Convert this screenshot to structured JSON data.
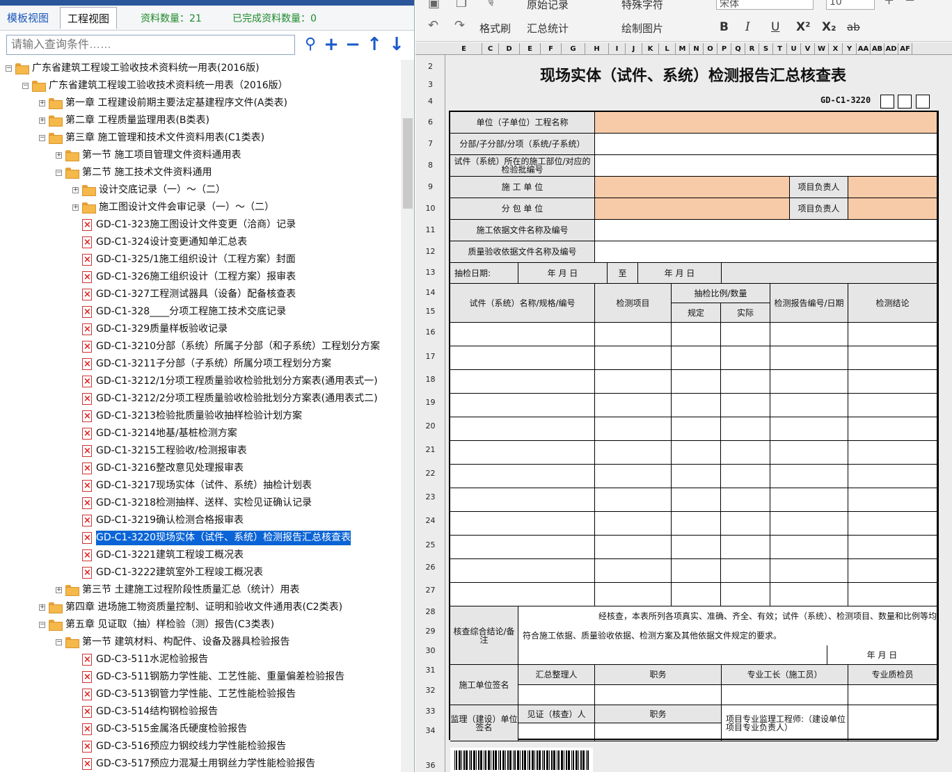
{
  "left_tabs": [
    "模板视图",
    "工程视图"
  ],
  "stats": {
    "count_label": "资料数量：21",
    "done_label": "已完成资料数量：0"
  },
  "search": {
    "placeholder": "请输入查询条件……"
  },
  "tools": [
    "⚲",
    "+",
    "−",
    "↑",
    "↓"
  ],
  "tree": [
    {
      "d": 0,
      "t": "广东省建筑工程竣工验收技术资料统一用表(2016版)",
      "k": "f",
      "e": "-"
    },
    {
      "d": 1,
      "t": "广东省建筑工程竣工验收技术资料统一用表（2016版）",
      "k": "f",
      "e": "-"
    },
    {
      "d": 2,
      "t": "第一章 工程建设前期主要法定基建程序文件(A类表)",
      "k": "f",
      "e": "+"
    },
    {
      "d": 2,
      "t": "第二章 工程质量监理用表(B类表)",
      "k": "f",
      "e": "+"
    },
    {
      "d": 2,
      "t": "第三章 施工管理和技术文件资料用表(C1类表)",
      "k": "f",
      "e": "-"
    },
    {
      "d": 3,
      "t": "第一节 施工项目管理文件资料通用表",
      "k": "f",
      "e": "+"
    },
    {
      "d": 3,
      "t": "第二节 施工技术文件资料通用",
      "k": "f",
      "e": "-"
    },
    {
      "d": 4,
      "t": "设计交底记录（一）～（二）",
      "k": "f",
      "e": "+"
    },
    {
      "d": 4,
      "t": "施工图设计文件会审记录（一）～（二）",
      "k": "f",
      "e": "+"
    },
    {
      "d": 4,
      "t": "GD-C1-323施工图设计文件变更（洽商）记录",
      "k": "d"
    },
    {
      "d": 4,
      "t": "GD-C1-324设计变更通知单汇总表",
      "k": "d"
    },
    {
      "d": 4,
      "t": "GD-C1-325/1施工组织设计（工程方案）封面",
      "k": "d"
    },
    {
      "d": 4,
      "t": "GD-C1-326施工组织设计（工程方案）报审表",
      "k": "d"
    },
    {
      "d": 4,
      "t": "GD-C1-327工程测试器具（设备）配备核查表",
      "k": "d"
    },
    {
      "d": 4,
      "t": "GD-C1-328____分项工程施工技术交底记录",
      "k": "d"
    },
    {
      "d": 4,
      "t": "GD-C1-329质量样板验收记录",
      "k": "d"
    },
    {
      "d": 4,
      "t": "GD-C1-3210分部（系统）所属子分部（和子系统）工程划分方案",
      "k": "d"
    },
    {
      "d": 4,
      "t": "GD-C1-3211子分部（子系统）所属分项工程划分方案",
      "k": "d"
    },
    {
      "d": 4,
      "t": "GD-C1-3212/1分项工程质量验收检验批划分方案表(通用表式一)",
      "k": "d"
    },
    {
      "d": 4,
      "t": "GD-C1-3212/2分项工程质量验收检验批划分方案表(通用表式二)",
      "k": "d"
    },
    {
      "d": 4,
      "t": "GD-C1-3213检验批质量验收抽样检验计划方案",
      "k": "d"
    },
    {
      "d": 4,
      "t": "GD-C1-3214地基/基桩检测方案",
      "k": "d"
    },
    {
      "d": 4,
      "t": "GD-C1-3215工程验收/检测报审表",
      "k": "d"
    },
    {
      "d": 4,
      "t": "GD-C1-3216整改意见处理报审表",
      "k": "d"
    },
    {
      "d": 4,
      "t": "GD-C1-3217现场实体（试件、系统）抽检计划表",
      "k": "d"
    },
    {
      "d": 4,
      "t": "GD-C1-3218检测抽样、送样、实检见证确认记录",
      "k": "d"
    },
    {
      "d": 4,
      "t": "GD-C1-3219确认检测合格报审表",
      "k": "d"
    },
    {
      "d": 4,
      "t": "GD-C1-3220现场实体（试件、系统）检测报告汇总核查表",
      "k": "d",
      "sel": true
    },
    {
      "d": 4,
      "t": "GD-C1-3221建筑工程竣工概况表",
      "k": "d"
    },
    {
      "d": 4,
      "t": "GD-C1-3222建筑室外工程竣工概况表",
      "k": "d"
    },
    {
      "d": 3,
      "t": "第三节 土建施工过程阶段性质量汇总（统计）用表",
      "k": "f",
      "e": "+"
    },
    {
      "d": 2,
      "t": "第四章 进场施工物资质量控制、证明和验收文件通用表(C2类表)",
      "k": "f",
      "e": "+"
    },
    {
      "d": 2,
      "t": "第五章 见证取（抽）样检验（测）报告(C3类表)",
      "k": "f",
      "e": "-"
    },
    {
      "d": 3,
      "t": "第一节 建筑材料、构配件、设备及器具检验报告",
      "k": "f",
      "e": "-"
    },
    {
      "d": 4,
      "t": "GD-C3-511水泥检验报告",
      "k": "d"
    },
    {
      "d": 4,
      "t": "GD-C3-511钢筋力学性能、工艺性能、重量偏差检验报告",
      "k": "d"
    },
    {
      "d": 4,
      "t": "GD-C3-513钢管力学性能、工艺性能检验报告",
      "k": "d"
    },
    {
      "d": 4,
      "t": "GD-C3-514结构钢检验报告",
      "k": "d"
    },
    {
      "d": 4,
      "t": "GD-C3-515金属洛氏硬度检验报告",
      "k": "d"
    },
    {
      "d": 4,
      "t": "GD-C3-516预应力钢绞线力学性能检验报告",
      "k": "d"
    },
    {
      "d": 4,
      "t": "GD-C3-517预应力混凝土用钢丝力学性能检验报告",
      "k": "d"
    }
  ],
  "ribbon": {
    "undo": "↶",
    "redo": "↷",
    "format": "格式刷",
    "orig": "原始记录",
    "sum": "汇总统计",
    "special": "特殊字符",
    "pic": "绘制图片",
    "font": "宋体",
    "size": "10",
    "bold": "B",
    "italic": "I",
    "under": "U",
    "sup": "X²",
    "sub": "X₂",
    "strike": "ab"
  },
  "cols": [
    "E",
    "C",
    "D",
    "E",
    "F",
    "G",
    "H",
    "I",
    "J",
    "K",
    "L",
    "M",
    "N",
    "O",
    "P",
    "Q",
    "R",
    "S",
    "T",
    "U",
    "V",
    "W",
    "X",
    "Y",
    "AA",
    "AB",
    "AD",
    "AF"
  ],
  "rows": [
    "2",
    "3",
    "4",
    "6",
    "7",
    "8",
    "9",
    "10",
    "11",
    "12",
    "13",
    "14",
    "15",
    "16",
    "17",
    "18",
    "19",
    "20",
    "21",
    "22",
    "23",
    "24",
    "25",
    "26",
    "27",
    "28",
    "29",
    "30",
    "31",
    "32",
    "33",
    "34",
    "36"
  ],
  "form": {
    "title": "现场实体（试件、系统）检测报告汇总核查表",
    "code": "GD-C1-3220",
    "unit_name": "单位（子单位）工程名称",
    "subdiv": "分部/子分部/分项（系统/子系统）",
    "location": "试件（系统）所在的施工部位/对应的检验批编号",
    "contractor": "施 工 单 位",
    "manager": "项目负责人",
    "subcontractor": "分 包 单 位",
    "manager2": "项目负责人",
    "basis": "施工依据文件名称及编号",
    "quality_basis": "质量验收依据文件名称及编号",
    "sample_date": "抽检日期:",
    "ymd1": "年   月   日",
    "to": "至",
    "ymd2": "年   月   日",
    "h_name": "试件（系统）名称/规格/编号",
    "h_item": "检测项目",
    "h_ratio": "抽检比例/数量",
    "h_spec": "规定",
    "h_actual": "实际",
    "h_report": "检测报告编号/日期",
    "h_concl": "检测结论",
    "review": "核查综合结论/备注",
    "review_text1": "经核查，本表所列各项真实、准确、齐全、有效；试件（系统）、检测项目、数量和比例等均",
    "review_text2": "符合施工依据、质量验收依据、检测方案及其他依据文件规定的要求。",
    "review_date": "年   月   日",
    "sign_contractor": "施工单位签名",
    "compiler": "汇总整理人",
    "duty": "职务",
    "foreman": "专业工长（施工员）",
    "qc": "专业质检员",
    "sign_super": "监理（建设）单位签名",
    "witness": "见证（核查）人",
    "duty2": "职务",
    "engineer": "项目专业监理工程师:（建设单位项目专业负责人）"
  }
}
